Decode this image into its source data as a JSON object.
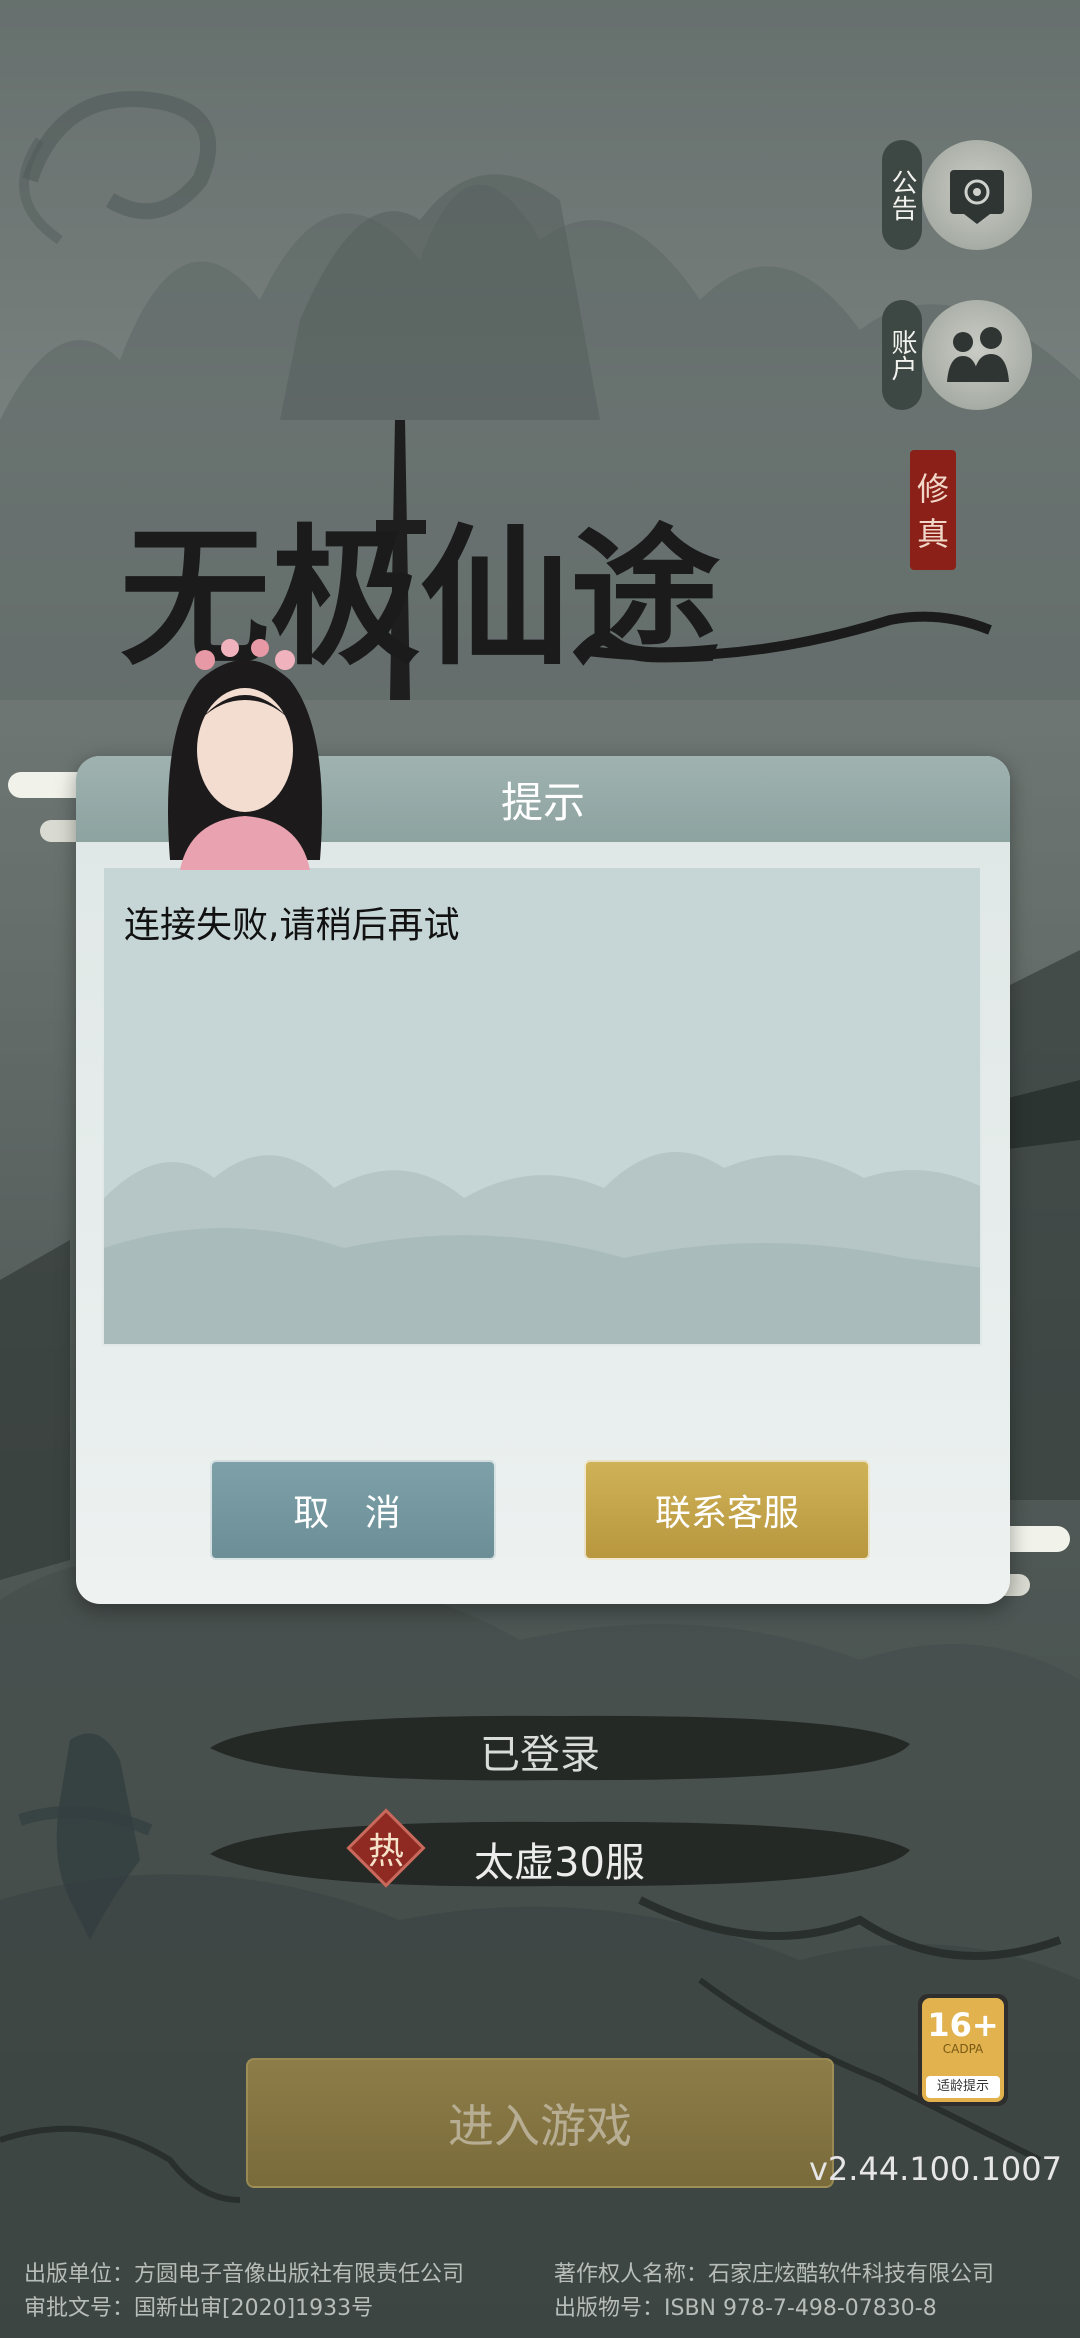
{
  "side_buttons": {
    "announcement_label": "公告",
    "account_label": "账户"
  },
  "logo": {
    "title": "无极仙途",
    "seal": "修真"
  },
  "dialog": {
    "title": "提示",
    "message": "连接失败,请稍后再试",
    "cancel_label": "取 消",
    "contact_label": "联系客服"
  },
  "login": {
    "status": "已登录",
    "hot_badge": "热",
    "server": "太虚30服",
    "enter_label": "进入游戏"
  },
  "age_rating": {
    "value": "16+",
    "org": "CADPA",
    "tip": "适龄提示"
  },
  "version": "v2.44.100.1007",
  "footer": {
    "publisher": "出版单位：方圆电子音像出版社有限责任公司",
    "copyright": "著作权人名称：石家庄炫酷软件科技有限公司",
    "approval": "审批文号：国新出审[2020]1933号",
    "isbn": "出版物号：ISBN 978-7-498-07830-8"
  },
  "colors": {
    "dialog_header": "#93a8a6",
    "cancel_button": "#7498a1",
    "contact_button": "#c4a64c",
    "hot_badge": "#8e2a22",
    "age_badge": "#e1b24e"
  }
}
